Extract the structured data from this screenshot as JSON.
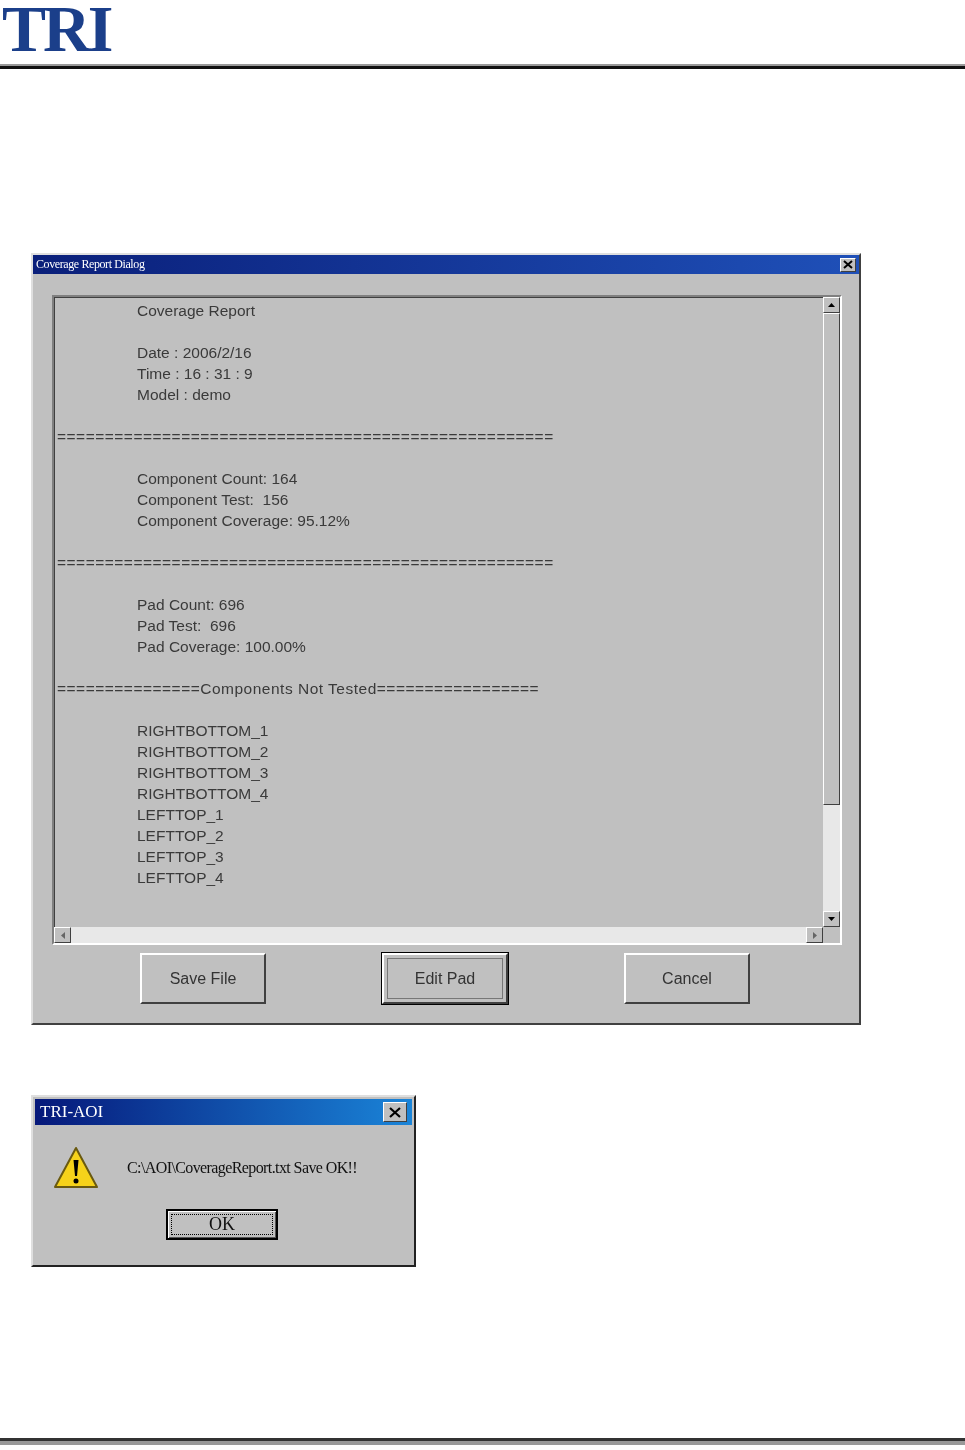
{
  "header": {
    "logo": "TRI"
  },
  "report_dialog": {
    "title": "Coverage Report Dialog",
    "report": [
      {
        "kind": "text",
        "lines": [
          "Coverage Report"
        ]
      },
      {
        "kind": "text",
        "lines": [
          "Date : 2006/2/16",
          "Time : 16 : 31 : 9",
          "Model : demo"
        ]
      },
      {
        "kind": "rule",
        "lines": [
          "===================================================="
        ]
      },
      {
        "kind": "text",
        "lines": [
          "Component Count: 164",
          "Component Test:  156",
          "Component Coverage: 95.12%"
        ]
      },
      {
        "kind": "rule",
        "lines": [
          "===================================================="
        ]
      },
      {
        "kind": "text",
        "lines": [
          "Pad Count: 696",
          "Pad Test:  696",
          "Pad Coverage: 100.00%"
        ]
      },
      {
        "kind": "rule",
        "lines": [
          "===============Components Not Tested================="
        ]
      },
      {
        "kind": "text",
        "lines": [
          "RIGHTBOTTOM_1",
          "RIGHTBOTTOM_2",
          "RIGHTBOTTOM_3",
          "RIGHTBOTTOM_4",
          "LEFTTOP_1",
          "LEFTTOP_2",
          "LEFTTOP_3",
          "LEFTTOP_4"
        ]
      }
    ],
    "buttons": [
      {
        "label": "Save File",
        "selected": false
      },
      {
        "label": "Edit Pad",
        "selected": true
      },
      {
        "label": "Cancel",
        "selected": false
      }
    ]
  },
  "message_box": {
    "title": "TRI-AOI",
    "message": "C:\\AOI\\CoverageReport.txt Save OK!!",
    "button": "OK"
  }
}
